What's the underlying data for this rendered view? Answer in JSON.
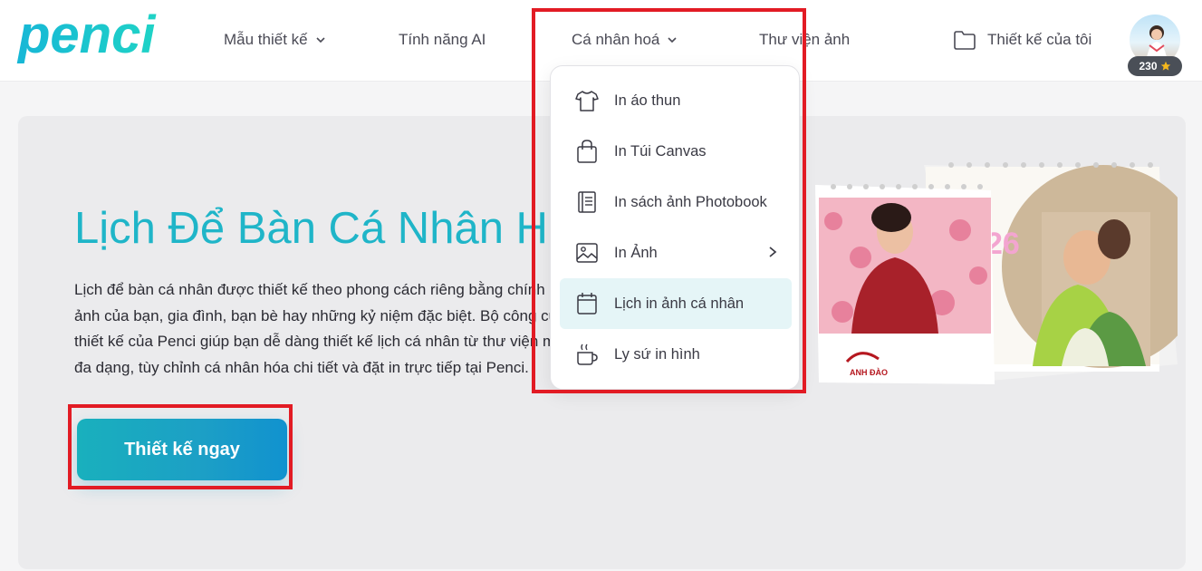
{
  "brand": {
    "logo_text": "penci"
  },
  "nav": {
    "items": [
      {
        "label": "Mẫu thiết kế",
        "has_caret": true
      },
      {
        "label": "Tính năng AI",
        "has_caret": false
      },
      {
        "label": "Cá nhân hoá",
        "has_caret": true
      },
      {
        "label": "Thư viện ảnh",
        "has_caret": false
      }
    ],
    "my_designs": "Thiết kế của tôi",
    "credits": "230",
    "credits_icon": "star-icon"
  },
  "dropdown": {
    "items": [
      {
        "label": "In áo thun",
        "icon": "tshirt-icon"
      },
      {
        "label": "In Túi Canvas",
        "icon": "bag-icon"
      },
      {
        "label": "In sách ảnh Photobook",
        "icon": "book-icon"
      },
      {
        "label": "In Ảnh",
        "icon": "image-icon",
        "has_submenu": true
      },
      {
        "label": "Lịch in ảnh cá nhân",
        "icon": "calendar-icon",
        "active": true
      },
      {
        "label": "Ly sứ in hình",
        "icon": "mug-icon"
      }
    ]
  },
  "hero": {
    "title": "Lịch Để Bàn Cá Nhân Hóa",
    "description": "Lịch để bàn cá nhân được thiết kế theo phong cách riêng bằng chính hình ảnh của bạn, gia đình, bạn bè hay những kỷ niệm đặc biệt. Bộ công cụ thiết kế của Penci giúp bạn dễ dàng thiết kế lịch cá nhân từ thư viện mẫu đa dạng, tùy chỉnh cá nhân hóa chi tiết và đặt in trực tiếp tại Penci.",
    "cta_label": "Thiết kế ngay",
    "calendar_year_fragment": "26",
    "calendar_brand": "ANH ĐÀO"
  },
  "colors": {
    "accent": "#1fb5c8",
    "highlight": "#e21b24",
    "active_item_bg": "#e5f5f7"
  }
}
